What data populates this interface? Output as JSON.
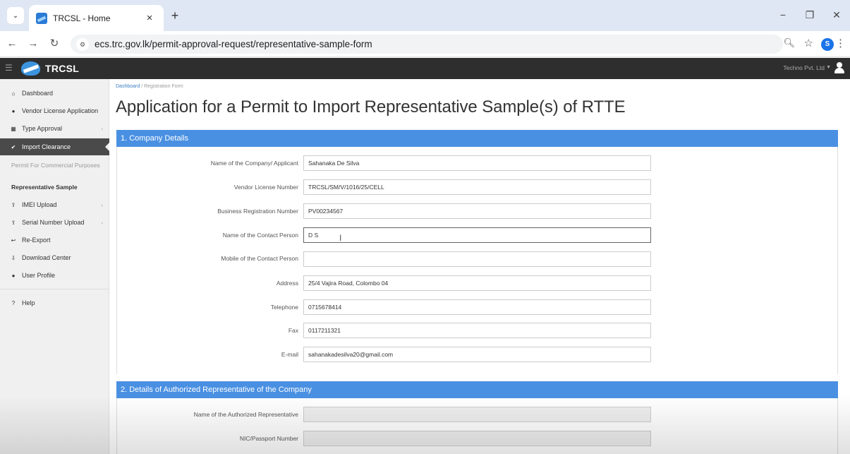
{
  "browser": {
    "tab_title": "TRCSL - Home",
    "tab_close": "×",
    "new_tab": "+",
    "tab_menu": "⌄",
    "url": "ecs.trc.gov.lk/permit-approval-request/representative-sample-form",
    "profile_initial": "S",
    "window_controls": {
      "minimize": "−",
      "restore": "❐",
      "close": "✕"
    }
  },
  "app": {
    "brand": "TRCSL",
    "user_menu": "Techno Pvt. Ltd"
  },
  "sidebar": {
    "items": [
      {
        "icon": "home-icon",
        "label": "Dashboard",
        "chevron": ""
      },
      {
        "icon": "user-icon",
        "label": "Vendor License Application",
        "chevron": ""
      },
      {
        "icon": "grid-icon",
        "label": "Type Approval",
        "chevron": "›"
      },
      {
        "icon": "check-circle-icon",
        "label": "Import Clearance",
        "chevron": "",
        "active": true
      },
      {
        "icon": "upload-icon",
        "label": "IMEI Upload",
        "chevron": "›"
      },
      {
        "icon": "upload-icon",
        "label": "Serial Number Upload",
        "chevron": "›"
      },
      {
        "icon": "reply-icon",
        "label": "Re-Export",
        "chevron": ""
      },
      {
        "icon": "download-icon",
        "label": "Download Center",
        "chevron": ""
      },
      {
        "icon": "user-icon",
        "label": "User Profile",
        "chevron": ""
      },
      {
        "icon": "help-icon",
        "label": "Help",
        "chevron": ""
      }
    ],
    "subitems": [
      {
        "label": "Permit For Commercial Purposes",
        "current": false
      },
      {
        "label": "Representative Sample",
        "current": true
      }
    ]
  },
  "breadcrumb": {
    "root": "Dashboard",
    "separator": "/",
    "current": "Registration Form"
  },
  "page": {
    "title": "Application for a Permit to Import Representative Sample(s) of RTTE"
  },
  "section1": {
    "title": "1. Company Details",
    "fields": [
      {
        "label": "Name of the Company/ Applicant",
        "value": "Sahanaka De Silva"
      },
      {
        "label": "Vendor License Number",
        "value": "TRCSL/SM/V/1016/25/CELL"
      },
      {
        "label": "Business Registration Number",
        "value": "PV00234567"
      },
      {
        "label": "Name of the Contact Person",
        "value": "D S"
      },
      {
        "label": "Mobile of the Contact Person",
        "value": ""
      },
      {
        "label": "Address",
        "value": "25/4 Vajira Road, Colombo 04"
      },
      {
        "label": "Telephone",
        "value": "0715678414"
      },
      {
        "label": "Fax",
        "value": "0117211321"
      },
      {
        "label": "E-mail",
        "value": "sahanakadesilva20@gmail.com"
      }
    ]
  },
  "section2": {
    "title": "2. Details of Authorized Representative of the Company",
    "fields": [
      {
        "label": "Name of the Authorized Representative",
        "value": ""
      },
      {
        "label": "NIC/Passport Number",
        "value": ""
      }
    ]
  }
}
